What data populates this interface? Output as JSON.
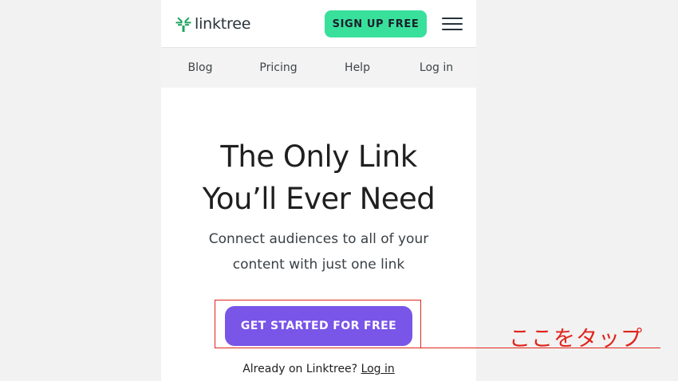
{
  "header": {
    "logo_text": "linktree",
    "signup_label": "SIGN UP FREE",
    "menu_icon": "hamburger-menu-icon",
    "logo_icon": "linktree-logo-icon"
  },
  "subnav": {
    "items": [
      "Blog",
      "Pricing",
      "Help",
      "Log in"
    ]
  },
  "hero": {
    "title_line1": "The Only Link",
    "title_line2": "You’ll Ever Need",
    "subtitle_line1": "Connect audiences to all of your",
    "subtitle_line2": "content with just one link",
    "cta_label": "GET STARTED FOR FREE",
    "already_text": "Already on Linktree?",
    "login_link": "Log in"
  },
  "annotation": {
    "callout_text": "ここをタップ"
  },
  "colors": {
    "brand_green": "#39e09b",
    "cta_purple": "#7955e8",
    "annotation_red": "#e0241b",
    "logo_green": "#1fa45e"
  }
}
